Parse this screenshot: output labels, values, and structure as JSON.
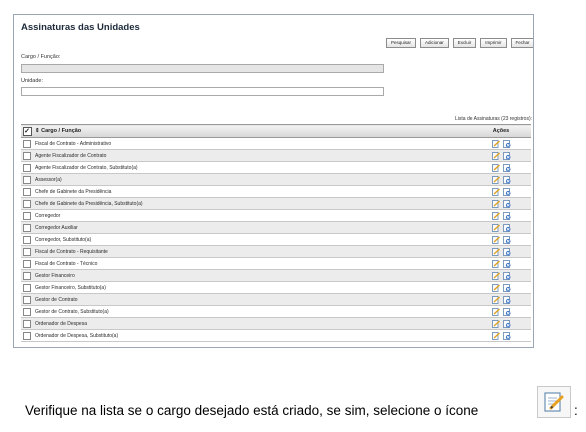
{
  "window": {
    "title": "Assinaturas das Unidades"
  },
  "toolbar": {
    "buttons": [
      "Pesquisar",
      "Adicionar",
      "Excluir",
      "Imprimir",
      "Fechar"
    ]
  },
  "form": {
    "cargo_label": "Cargo / Função:",
    "cargo_value": "",
    "unidade_label": "Unidade:",
    "unidade_value": ""
  },
  "list_info": "Lista de Assinaturas (23 registros):",
  "table": {
    "headers": {
      "cargo": "Cargo / Função",
      "acoes": "Ações",
      "sort_glyph": "⇕",
      "check_glyph": "✓"
    },
    "rows": [
      "Fiscal de Contrato - Administrativo",
      "Agente Fiscalizador de Contrato",
      "Agente Fiscalizador de Contrato, Substituto(a)",
      "Assessor(a)",
      "Chefe de Gabinete da Presidência",
      "Chefe de Gabinete da Presidência, Substituto(a)",
      "Corregedor",
      "Corregedor Auxiliar",
      "Corregedor, Substituto(a)",
      "Fiscal de Contrato - Requisitante",
      "Fiscal de Contrato - Técnico",
      "Gestor Financeiro",
      "Gestor Financeiro, Substituto(a)",
      "Gestor de Contrato",
      "Gestor de Contrato, Substituto(a)",
      "Ordenador de Despesa",
      "Ordenador de Despesa, Substituto(a)"
    ]
  },
  "row_icons": [
    "edit-icon",
    "delete-icon"
  ],
  "instruction": {
    "text": "Verifique na lista se o cargo desejado está criado, se sim, selecione o ícone",
    "tail": ":"
  },
  "colors": {
    "row_alt": "#ececec",
    "header_gradient_end": "#d6d6d6",
    "frame_border": "#9aa6b5"
  }
}
